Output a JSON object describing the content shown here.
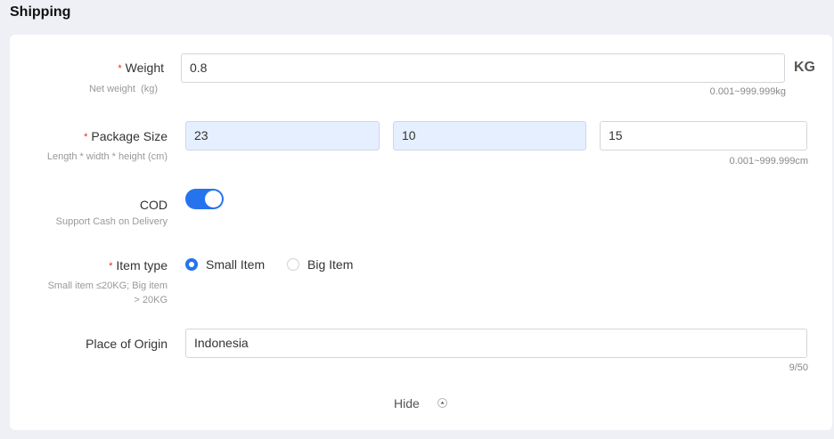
{
  "section": {
    "title": "Shipping"
  },
  "weight": {
    "label": "Weight",
    "hint": "Net weight  (kg)",
    "value": "0.8",
    "unit": "KG",
    "range": "0.001~999.999kg"
  },
  "package_size": {
    "label": "Package Size",
    "hint": "Length * width * height (cm)",
    "length": "23",
    "width": "10",
    "height": "15",
    "range": "0.001~999.999cm"
  },
  "cod": {
    "label": "COD",
    "hint": "Support Cash on Delivery",
    "enabled": true
  },
  "item_type": {
    "label": "Item type",
    "hint_line1": "Small item ≤20KG; Big item",
    "hint_line2": "> 20KG",
    "options": [
      {
        "label": "Small Item",
        "selected": true
      },
      {
        "label": "Big Item",
        "selected": false
      }
    ]
  },
  "origin": {
    "label": "Place of Origin",
    "value": "Indonesia",
    "counter": "9/50"
  },
  "footer": {
    "hide_label": "Hide"
  },
  "colors": {
    "accent": "#2673ee",
    "required": "#ee2222",
    "filled_input": "#e6efff"
  },
  "icons": {
    "hide": "chevron-up-icon"
  }
}
